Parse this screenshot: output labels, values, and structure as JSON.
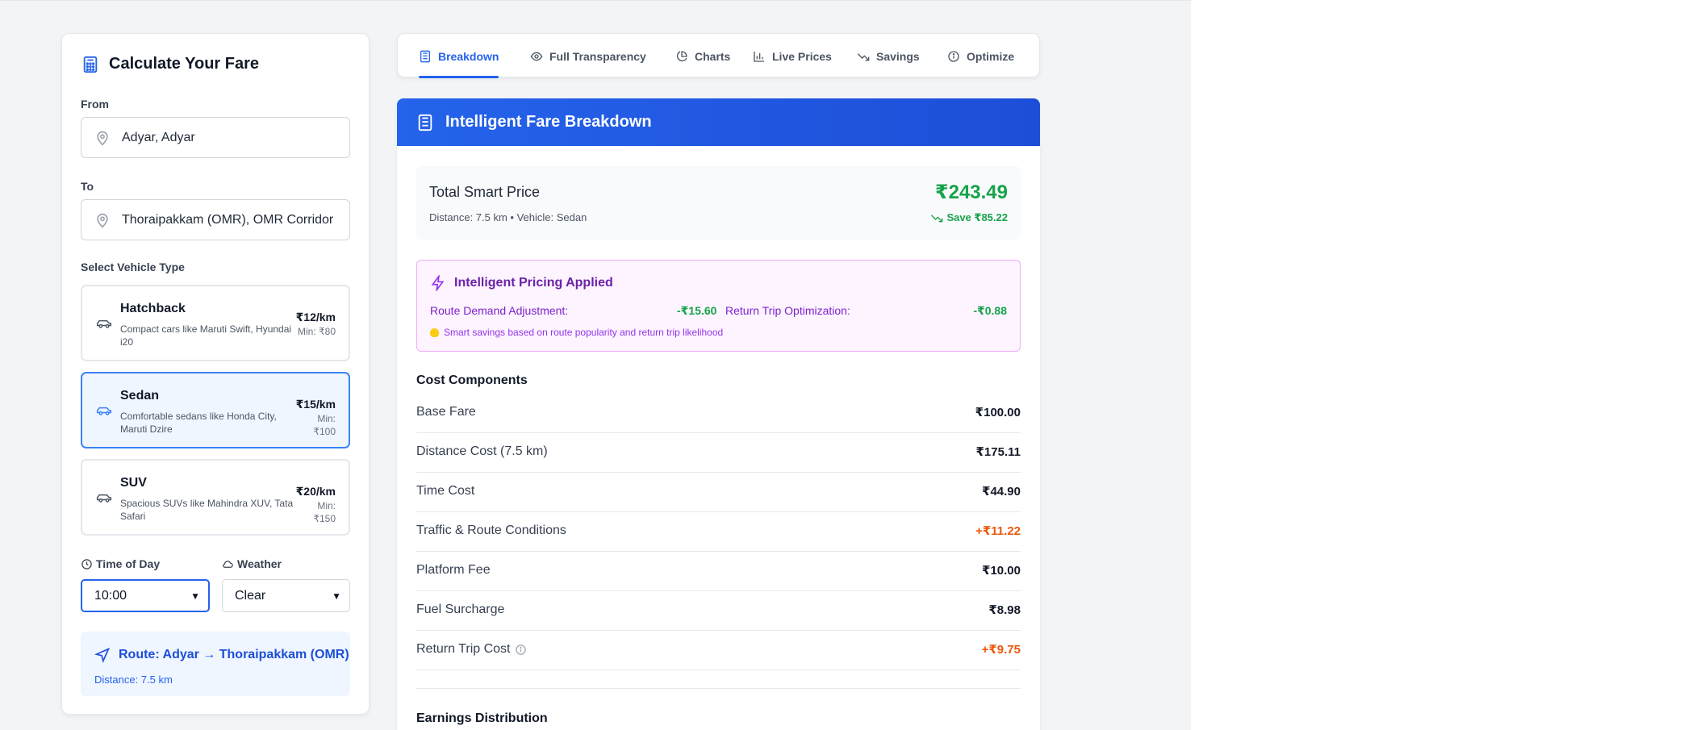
{
  "left": {
    "title": "Calculate Your Fare",
    "from_label": "From",
    "from_value": "Adyar, Adyar",
    "to_label": "To",
    "to_value": "Thoraipakkam (OMR), OMR Corridor",
    "vehicle_label": "Select Vehicle Type",
    "vehicles": [
      {
        "name": "Hatchback",
        "desc": "Compact cars like Maruti Swift, Hyundai i20",
        "price": "₹12/km",
        "min": "Min: ₹80"
      },
      {
        "name": "Sedan",
        "desc": "Comfortable sedans like Honda City, Maruti Dzire",
        "price": "₹15/km",
        "min": "Min: ₹100"
      },
      {
        "name": "SUV",
        "desc": "Spacious SUVs like Mahindra XUV, Tata Safari",
        "price": "₹20/km",
        "min": "Min: ₹150"
      }
    ],
    "time_label": "Time of Day",
    "time_value": "10:00",
    "weather_label": "Weather",
    "weather_value": "Clear",
    "route_title": "Route: Adyar → Thoraipakkam (OMR)",
    "route_distance": "Distance: 7.5 km"
  },
  "tabs": [
    "Breakdown",
    "Full Transparency",
    "Charts",
    "Live Prices",
    "Savings",
    "Optimize"
  ],
  "breakdown": {
    "header": "Intelligent Fare Breakdown",
    "total_label": "Total Smart Price",
    "total_sub": "Distance: 7.5 km • Vehicle: Sedan",
    "total_price": "₹243.49",
    "save_text": "Save ₹85.22",
    "intel_title": "Intelligent Pricing Applied",
    "route_demand_label": "Route Demand Adjustment:",
    "route_demand_value": "-₹15.60",
    "return_opt_label": "Return Trip Optimization:",
    "return_opt_value": "-₹0.88",
    "intel_hint": "Smart savings based on route popularity and return trip likelihood",
    "cost_title": "Cost Components",
    "costs": [
      {
        "label": "Base Fare",
        "value": "₹100.00"
      },
      {
        "label": "Distance Cost (7.5 km)",
        "value": "₹175.11"
      },
      {
        "label": "Time Cost",
        "value": "₹44.90"
      },
      {
        "label": "Traffic & Route Conditions",
        "value": "+₹11.22"
      },
      {
        "label": "Platform Fee",
        "value": "₹10.00"
      },
      {
        "label": "Fuel Surcharge",
        "value": "₹8.98"
      },
      {
        "label": "Return Trip Cost",
        "value": "+₹9.75"
      }
    ],
    "earnings_title": "Earnings Distribution"
  },
  "colors": {
    "accent": "#2563eb",
    "green": "#16a34a",
    "orange": "#ea580c",
    "purple": "#6b21a8"
  }
}
